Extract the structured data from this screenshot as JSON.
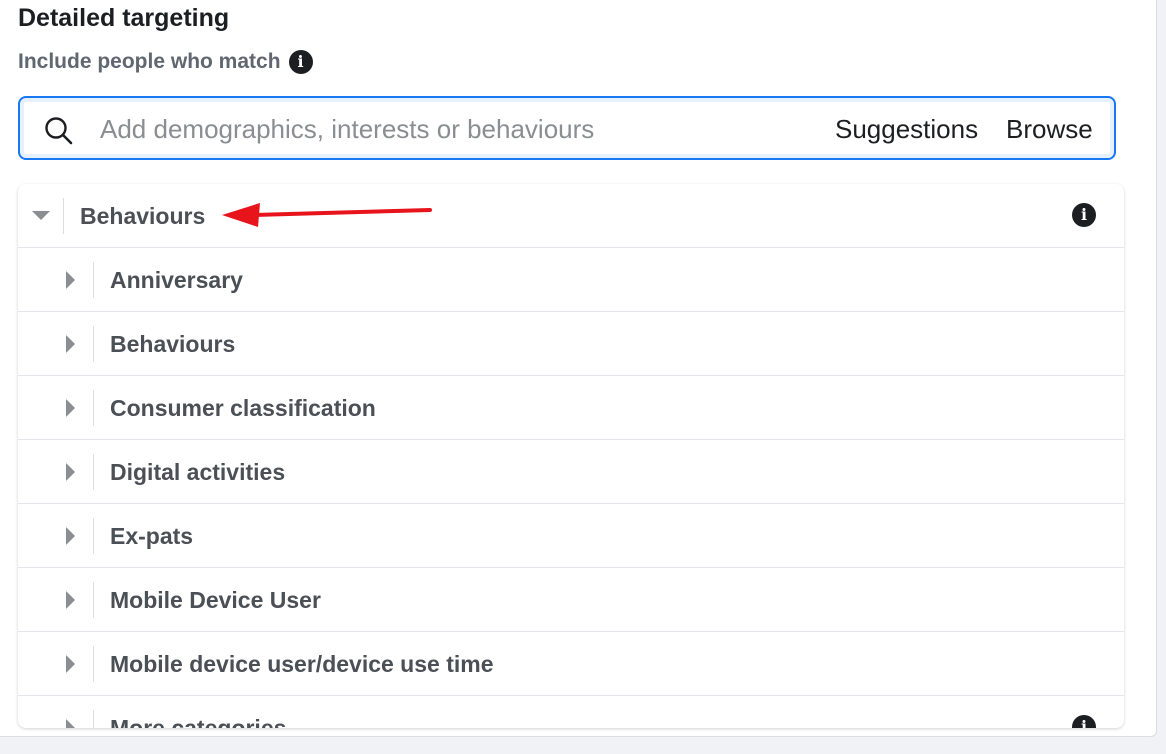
{
  "header": {
    "title": "Detailed targeting",
    "subtitle": "Include people who match"
  },
  "search": {
    "placeholder": "Add demographics, interests or behaviours",
    "suggestions_label": "Suggestions",
    "browse_label": "Browse"
  },
  "tree": {
    "root": {
      "label": "Behaviours",
      "expanded": true,
      "info_icon": "info-icon"
    },
    "children": [
      {
        "label": "Anniversary"
      },
      {
        "label": "Behaviours"
      },
      {
        "label": "Consumer classification"
      },
      {
        "label": "Digital activities"
      },
      {
        "label": "Ex-pats"
      },
      {
        "label": "Mobile Device User"
      },
      {
        "label": "Mobile device user/device use time"
      },
      {
        "label": "More categories"
      }
    ]
  },
  "colors": {
    "accent": "#1877f2",
    "annotation_arrow": "#e8141b",
    "label_text": "#4b4f56"
  }
}
